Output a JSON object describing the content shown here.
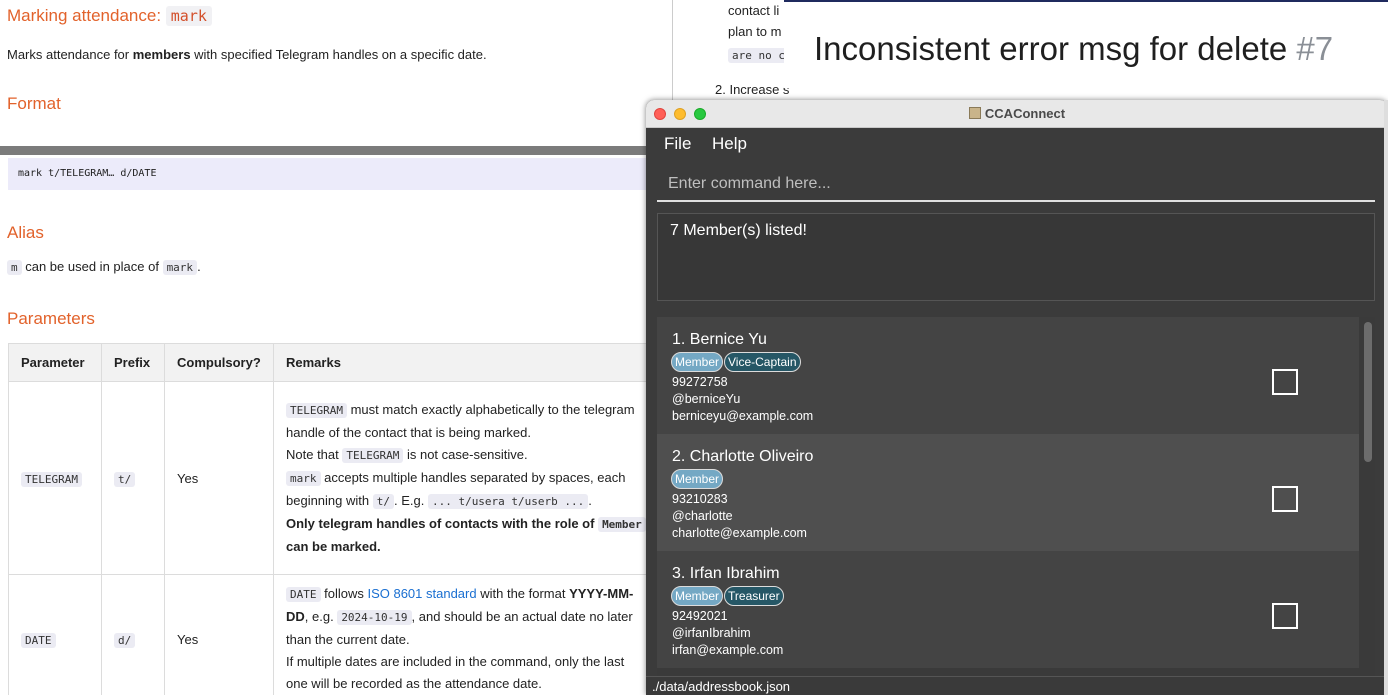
{
  "doc": {
    "heading_text": "Marking attendance:",
    "heading_code": "mark",
    "intro_pre": "Marks attendance for ",
    "intro_bold": "members",
    "intro_post": " with specified Telegram handles on a specific date.",
    "format_heading": "Format",
    "format_code": "mark t/TELEGRAM… d/DATE",
    "alias_heading": "Alias",
    "alias_code1": "m",
    "alias_text": " can be used in place of ",
    "alias_code2": "mark",
    "alias_end": ".",
    "params_heading": "Parameters",
    "table": {
      "headers": [
        "Parameter",
        "Prefix",
        "Compulsory?",
        "Remarks"
      ],
      "rows": [
        {
          "param": "TELEGRAM",
          "prefix": "t/",
          "compulsory": "Yes",
          "r1_code": "TELEGRAM",
          "r1_text": " must match exactly alphabetically to the telegram handle of the contact that is being marked.",
          "r2_pre": "Note that ",
          "r2_code": "TELEGRAM",
          "r2_post": " is not case-sensitive.",
          "r3_code": "mark",
          "r3_text": " accepts multiple handles separated by spaces, each beginning with ",
          "r3_code2": "t/",
          "r3_text2": ". E.g. ",
          "r3_code3": "... t/usera t/userb ...",
          "r3_end": ".",
          "r4_bold_pre": "Only telegram handles of contacts with the role of ",
          "r4_code": "Member",
          "r4_bold_post": " can be marked."
        },
        {
          "param": "DATE",
          "prefix": "d/",
          "compulsory": "Yes",
          "r1_code": "DATE",
          "r1_text": " follows ",
          "r1_link": "ISO 8601 standard",
          "r1_text2": " with the format ",
          "r1_bold": "YYYY-MM-DD",
          "r1_text3": ", e.g. ",
          "r1_code2": "2024-10-19",
          "r1_text4": ", and should be an actual date no later than the current date.",
          "r2_text": "If multiple dates are included in the command, only the last one will be recorded as the attendance date."
        }
      ]
    }
  },
  "bg_window": {
    "line1": "contact li",
    "line2": "plan to m",
    "line3_code": "are no c",
    "line4": "2. Increase s"
  },
  "issue": {
    "title": "Inconsistent error msg for delete",
    "number": "#7"
  },
  "app": {
    "window_title": "CCAConnect",
    "menu": [
      "File",
      "Help"
    ],
    "command_placeholder": "Enter command here...",
    "result_text": "7 Member(s) listed!",
    "status_path": "./data/addressbook.json",
    "members": [
      {
        "name": "1. Bernice Yu",
        "tags": [
          "Member",
          "Vice-Captain"
        ],
        "phone": "99272758",
        "telegram": "@berniceYu",
        "email": "berniceyu@example.com",
        "checked": false
      },
      {
        "name": "2. Charlotte Oliveiro",
        "tags": [
          "Member"
        ],
        "phone": "93210283",
        "telegram": "@charlotte",
        "email": "charlotte@example.com",
        "checked": false
      },
      {
        "name": "3. Irfan Ibrahim",
        "tags": [
          "Member",
          "Treasurer"
        ],
        "phone": "92492021",
        "telegram": "@irfanIbrahim",
        "email": "irfan@example.com",
        "checked": false
      }
    ]
  },
  "colors": {
    "heading_orange": "#e2622b",
    "app_bg": "#3b3b3b",
    "tag_member": "#74a8c4",
    "tag_role": "#265766",
    "link_blue": "#1a6fd1"
  }
}
